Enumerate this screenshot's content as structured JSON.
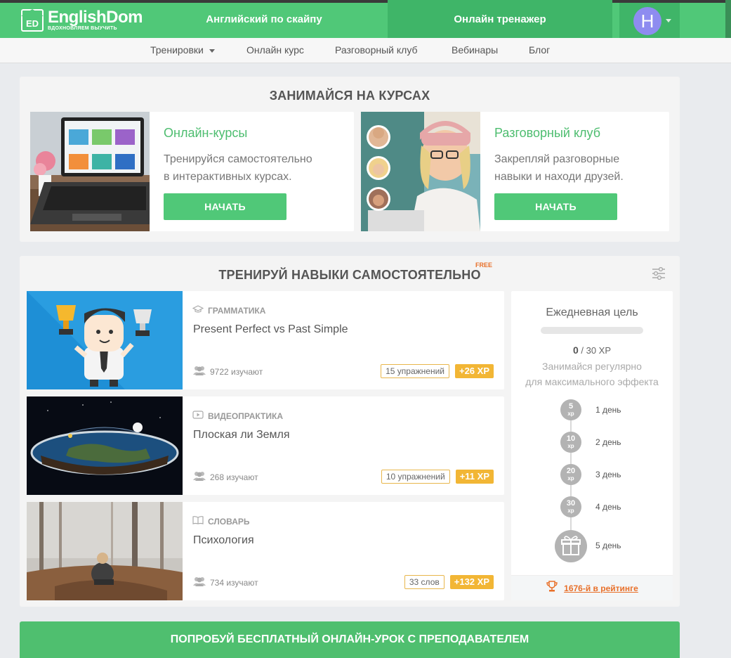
{
  "header": {
    "logo_mark": "ED",
    "logo_name": "EnglishDom",
    "logo_tagline": "ВДОХНОВЛЯЕМ ВЫУЧИТЬ",
    "nav": [
      "Английский по скайпу",
      "Онлайн тренажер"
    ],
    "avatar_letter": "H",
    "colors": {
      "primary": "#50c878",
      "active": "#3fb568",
      "avatar": "#8e8cf0"
    }
  },
  "subnav": {
    "items": [
      "Тренировки",
      "Онлайн курс",
      "Разговорный клуб",
      "Вебинары",
      "Блог"
    ]
  },
  "courses": {
    "title": "ЗАНИМАЙСЯ НА КУРСАХ",
    "cards": [
      {
        "title": "Онлайн-курсы",
        "desc1": "Тренируйся самостоятельно",
        "desc2": "в интерактивных курсах.",
        "button": "НАЧАТЬ"
      },
      {
        "title": "Разговорный клуб",
        "desc1": "Закрепляй разговорные",
        "desc2": "навыки и находи друзей.",
        "button": "НАЧАТЬ"
      }
    ]
  },
  "training": {
    "title": "ТРЕНИРУЙ НАВЫКИ САМОСТОЯТЕЛЬНО",
    "free_badge": "FREE",
    "cards": [
      {
        "category": "ГРАММАТИКА",
        "title": "Present Perfect vs Past Simple",
        "learners": "9722 изучают",
        "count": "15 упражнений",
        "xp": "+26 XP",
        "icon": "graduation-cap-icon"
      },
      {
        "category": "ВИДЕОПРАКТИКА",
        "title": "Плоская ли Земля",
        "learners": "268 изучают",
        "count": "10 упражнений",
        "xp": "+11 XP",
        "icon": "play-icon"
      },
      {
        "category": "СЛОВАРЬ",
        "title": "Психология",
        "learners": "734 изучают",
        "count": "33 слов",
        "xp": "+132 XP",
        "icon": "book-icon"
      }
    ]
  },
  "daily_goal": {
    "title": "Ежедневная цель",
    "progress": 0,
    "value": "0",
    "target": "/ 30 XP",
    "hint1": "Занимайся регулярно",
    "hint2": "для максимального эффекта",
    "steps": [
      {
        "xp": "5",
        "unit": "xp",
        "label": "1 день"
      },
      {
        "xp": "10",
        "unit": "xp",
        "label": "2 день"
      },
      {
        "xp": "20",
        "unit": "xp",
        "label": "3 день"
      },
      {
        "xp": "30",
        "unit": "xp",
        "label": "4 день"
      },
      {
        "xp": "",
        "unit": "",
        "label": "5 день"
      }
    ],
    "rank": "1676-й в рейтинге"
  },
  "cta": {
    "label": "ПОПРОБУЙ БЕСПЛАТНЫЙ ОНЛАЙН-УРОК С ПРЕПОДАВАТЕЛЕМ"
  }
}
